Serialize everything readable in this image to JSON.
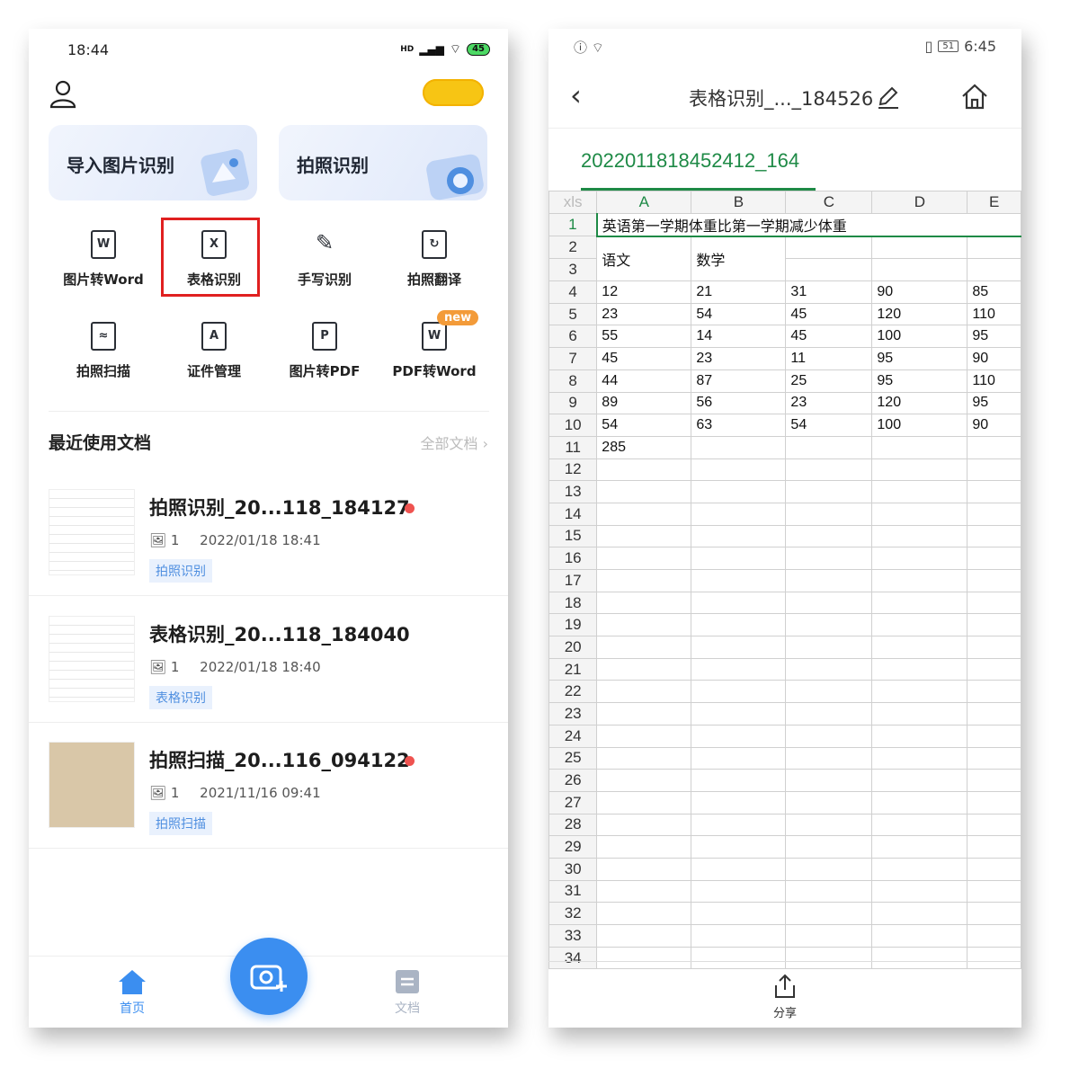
{
  "left": {
    "status": {
      "time": "18:44",
      "signal": "HD",
      "battery": "45"
    },
    "cards": [
      {
        "label": "导入图片识别"
      },
      {
        "label": "拍照识别"
      }
    ],
    "tools": [
      {
        "label": "图片转Word",
        "glyph": "W"
      },
      {
        "label": "表格识别",
        "glyph": "X"
      },
      {
        "label": "手写识别",
        "glyph": "✎"
      },
      {
        "label": "拍照翻译",
        "glyph": "↻"
      },
      {
        "label": "拍照扫描",
        "glyph": "≈"
      },
      {
        "label": "证件管理",
        "glyph": "A"
      },
      {
        "label": "图片转PDF",
        "glyph": "P"
      },
      {
        "label": "PDF转Word",
        "glyph": "W"
      }
    ],
    "new_badge": "new",
    "recent": {
      "title": "最近使用文档",
      "all_link": "全部文档"
    },
    "docs": [
      {
        "title": "拍照识别_20...118_184127",
        "count": "1",
        "date": "2022/01/18 18:41",
        "tag": "拍照识别",
        "unread": true
      },
      {
        "title": "表格识别_20...118_184040",
        "count": "1",
        "date": "2022/01/18 18:40",
        "tag": "表格识别",
        "unread": false
      },
      {
        "title": "拍照扫描_20...116_094122",
        "count": "1",
        "date": "2021/11/16 09:41",
        "tag": "拍照扫描",
        "unread": true
      }
    ],
    "nav": {
      "home": "首页",
      "docs": "文档"
    },
    "colors": {
      "accent": "#3b8ef0",
      "highlight_box": "#e02020",
      "toggle": "#f7c514"
    }
  },
  "right": {
    "status": {
      "time": "6:45",
      "battery": "51"
    },
    "title": "表格识别_..._184526",
    "sheet_tab": "2022011818452412_164",
    "corner": "xls",
    "columns": [
      "A",
      "B",
      "C",
      "D",
      "E"
    ],
    "merged_title": "英语第一学期体重比第一学期减少体重",
    "subjects": [
      "语文",
      "数学"
    ],
    "rows": [
      [
        "12",
        "21",
        "31",
        "90",
        "85"
      ],
      [
        "23",
        "54",
        "45",
        "120",
        "110"
      ],
      [
        "55",
        "14",
        "45",
        "100",
        "95"
      ],
      [
        "45",
        "23",
        "11",
        "95",
        "90"
      ],
      [
        "44",
        "87",
        "25",
        "95",
        "110"
      ],
      [
        "89",
        "56",
        "23",
        "120",
        "95"
      ],
      [
        "54",
        "63",
        "54",
        "100",
        "90"
      ]
    ],
    "total": "285",
    "share_label": "分享",
    "colors": {
      "sheet_green": "#1e8a46"
    }
  }
}
